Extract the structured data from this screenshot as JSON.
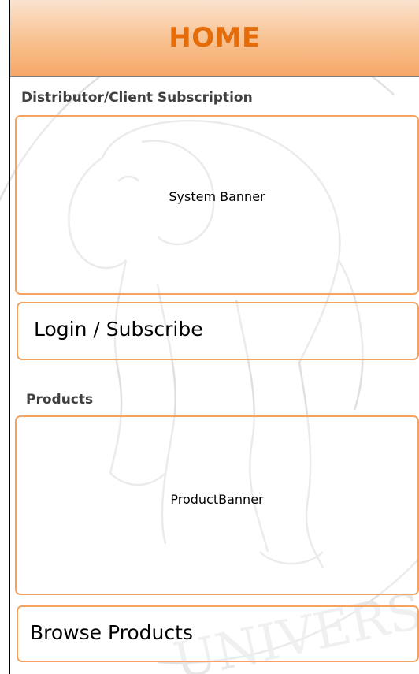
{
  "header": {
    "title": "HOME"
  },
  "subscription": {
    "section_label": "Distributor/Client Subscription",
    "banner_label": "System Banner",
    "login_label": "Login / Subscribe"
  },
  "products": {
    "section_label": "Products",
    "banner_label": "ProductBanner",
    "browse_label": "Browse Products"
  },
  "colors": {
    "accent": "#e46c0a",
    "box_border": "#f4a460",
    "header_top": "#fbe3cf",
    "header_bottom": "#f6a868"
  },
  "icons": {
    "watermark": "elephant-seal-watermark-icon"
  }
}
